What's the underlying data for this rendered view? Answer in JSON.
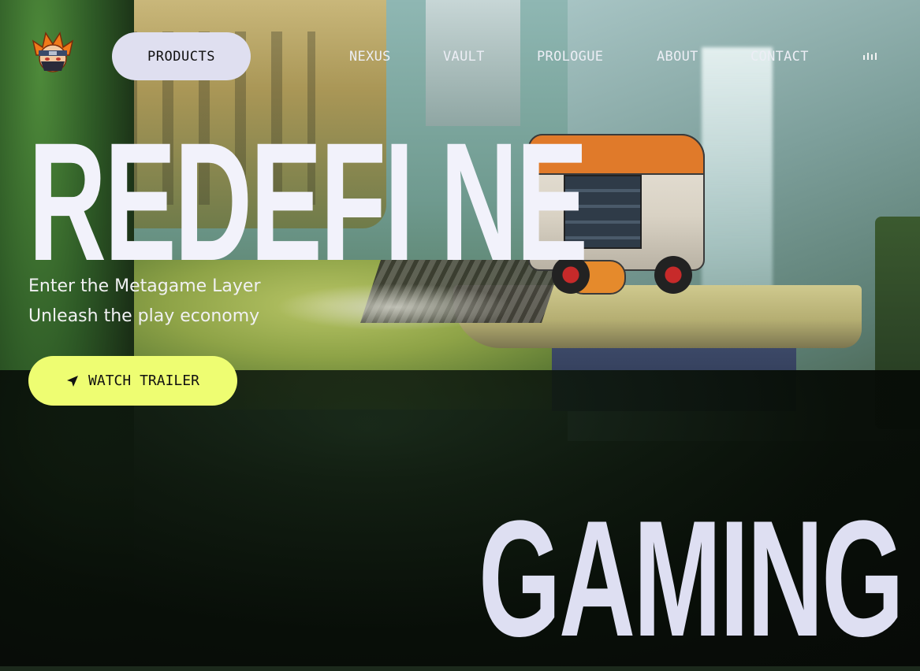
{
  "nav": {
    "products_label": "PRODUCTS",
    "links": [
      {
        "label": "NEXUS"
      },
      {
        "label": "VAULT"
      },
      {
        "label": "PROLOGUE"
      },
      {
        "label": "ABOUT"
      },
      {
        "label": "CONTACT"
      }
    ],
    "audio_icon": "audio-bars-icon"
  },
  "hero": {
    "title": "REDEFI NE",
    "subtitle_line1": "Enter the Metagame Layer",
    "subtitle_line2": "Unleash the play economy",
    "cta_label": "WATCH TRAILER",
    "cta_icon": "navigation-arrow-icon",
    "bottom_title": "GAMING"
  },
  "colors": {
    "nav_button_bg": "#dfdff0",
    "cta_bg": "#eefd72",
    "title_text": "#f2f2fb"
  }
}
